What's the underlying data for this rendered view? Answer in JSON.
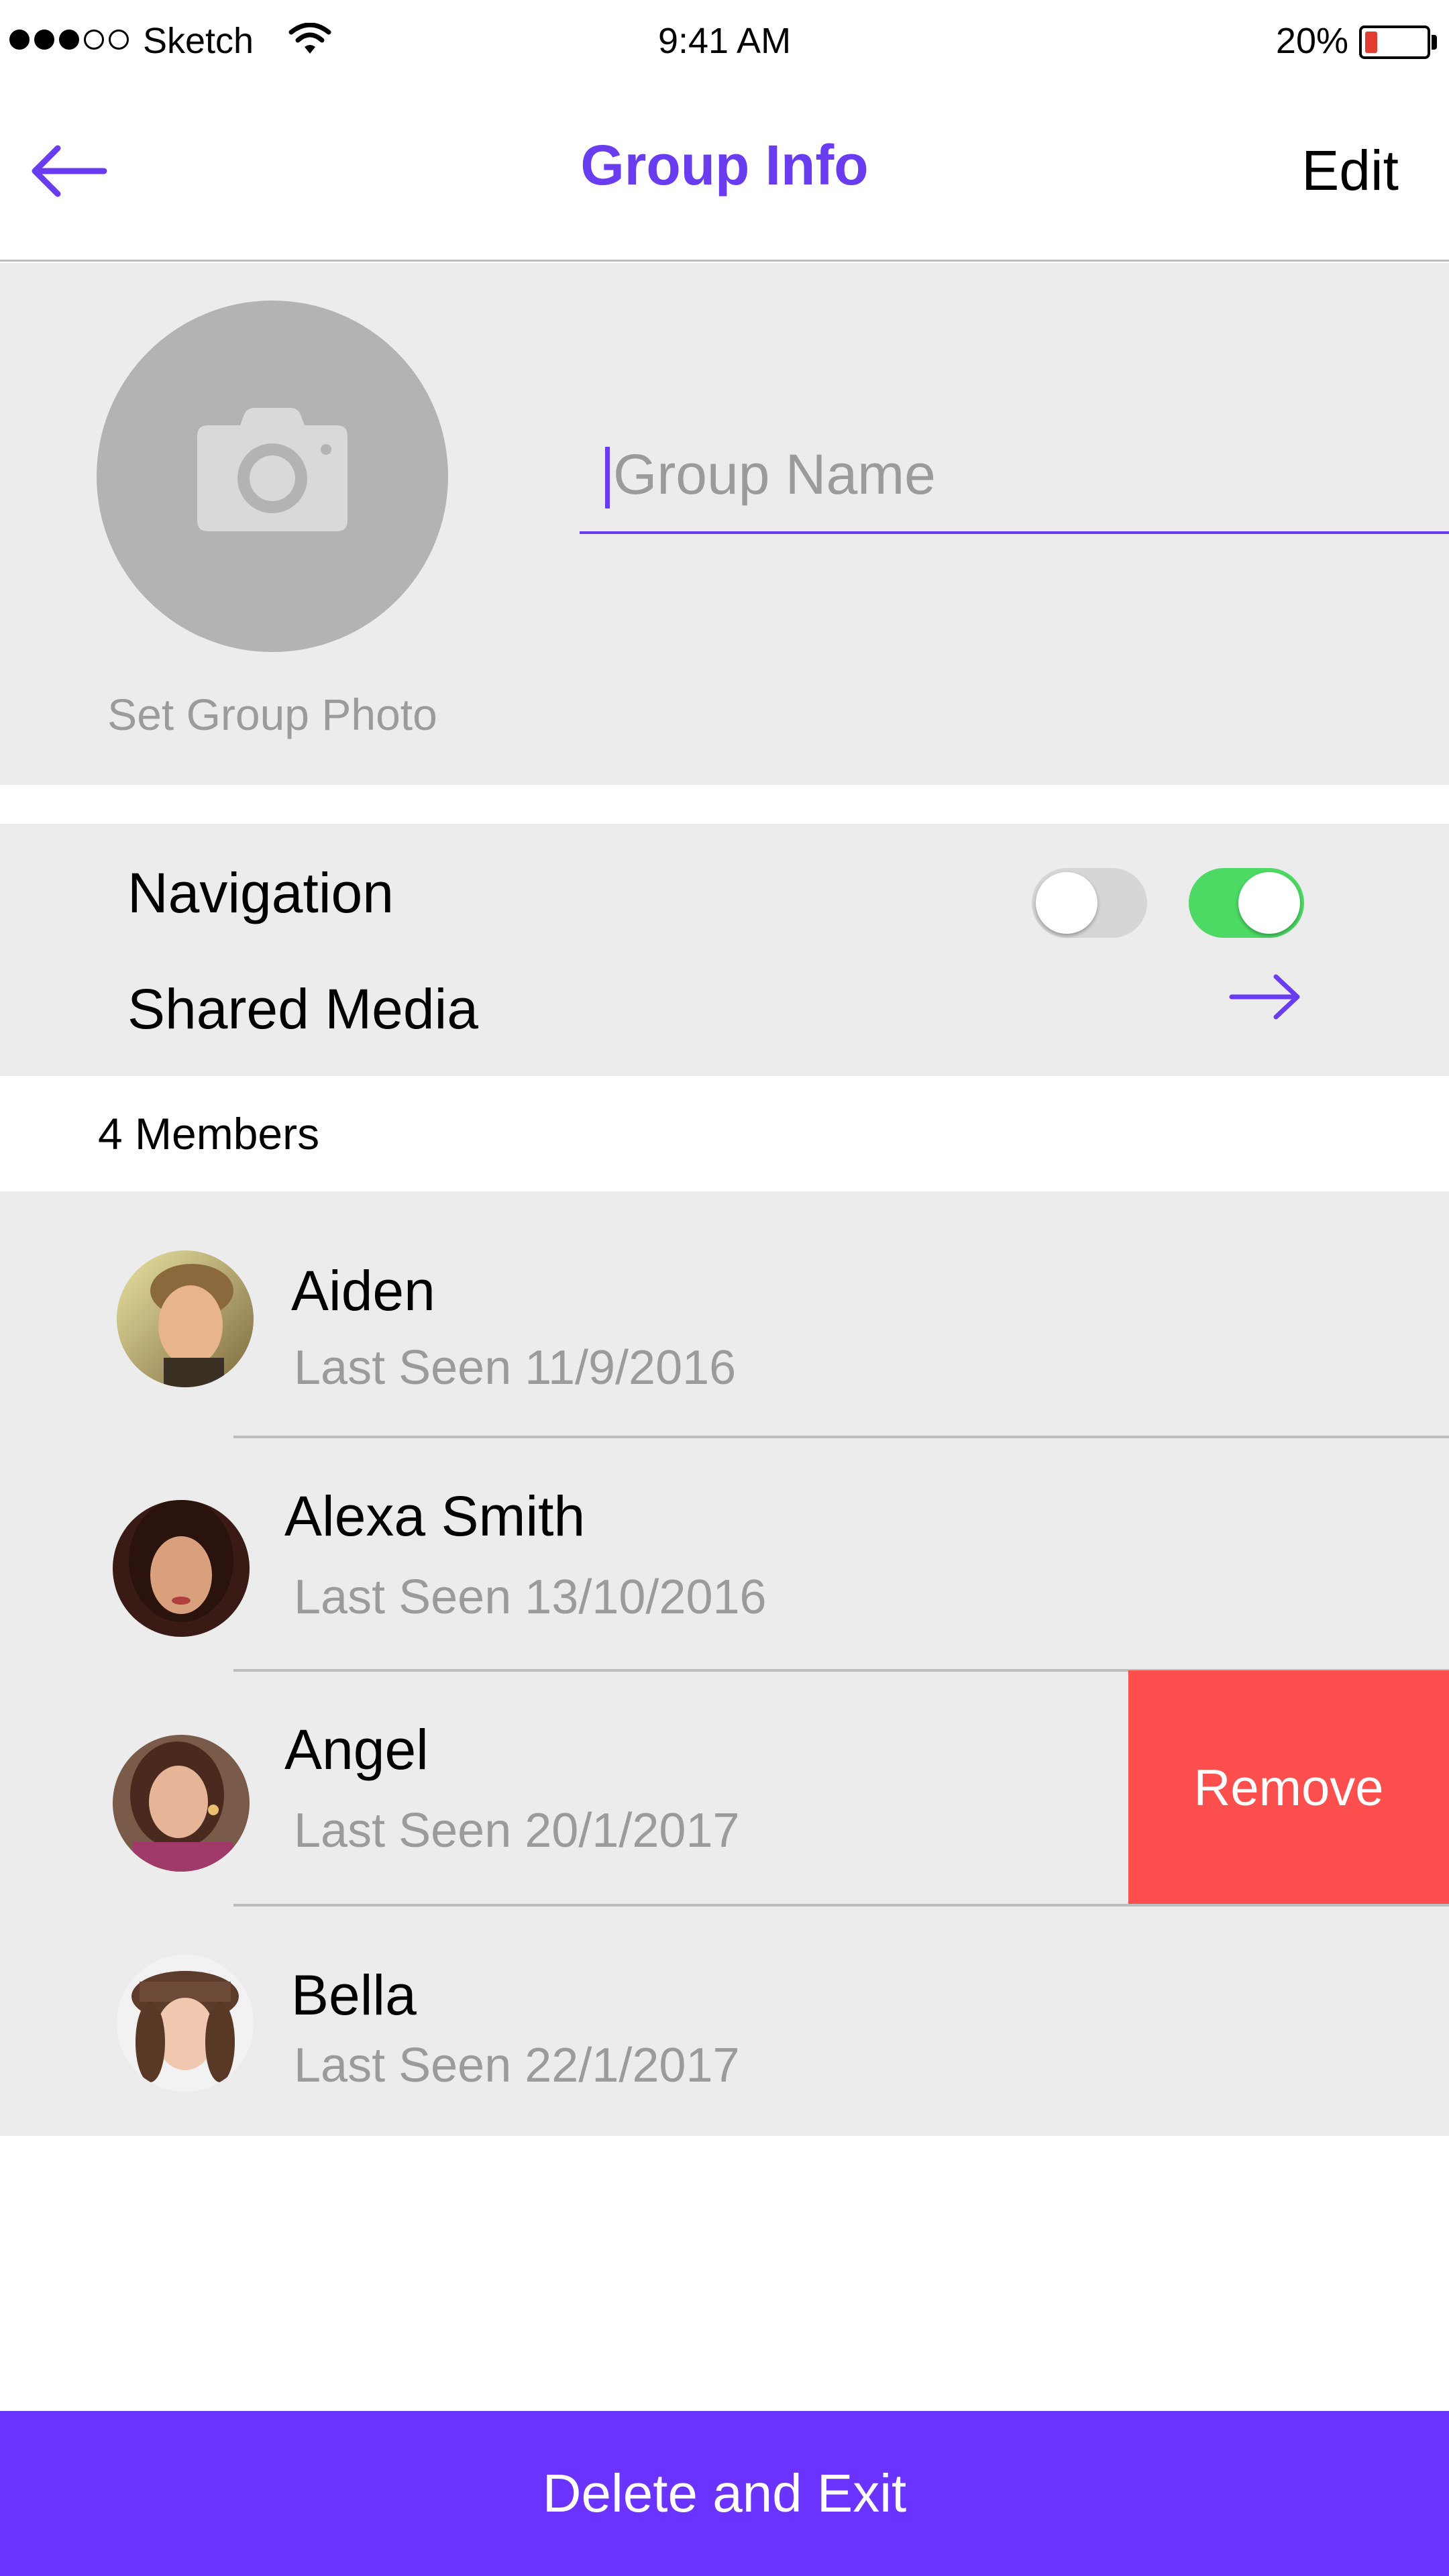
{
  "status_bar": {
    "carrier": "Sketch",
    "time": "9:41 AM",
    "battery_percent": "20%",
    "battery_level": 0.2,
    "signal_strength": 3,
    "signal_total": 5
  },
  "nav": {
    "title": "Group Info",
    "edit_label": "Edit",
    "back_icon": "arrow-left-icon"
  },
  "group": {
    "photo_label": "Set Group Photo",
    "name_placeholder": "Group Name",
    "camera_icon": "camera-icon"
  },
  "settings": {
    "items": [
      {
        "label": "Navigation"
      },
      {
        "label": "Shared Media"
      }
    ],
    "toggles": [
      {
        "state": "off"
      },
      {
        "state": "on"
      }
    ]
  },
  "members": {
    "count_label": "4 Members",
    "items": [
      {
        "name": "Aiden",
        "last_seen": "Last Seen 11/9/2016"
      },
      {
        "name": "Alexa Smith",
        "last_seen": "Last Seen 13/10/2016"
      },
      {
        "name": "Angel",
        "last_seen": "Last Seen 20/1/2017"
      },
      {
        "name": "Bella",
        "last_seen": "Last Seen 22/1/2017"
      }
    ],
    "remove_label": "Remove"
  },
  "footer": {
    "delete_exit_label": "Delete and Exit"
  },
  "colors": {
    "accent": "#6a3cf0",
    "primary_button": "#6a33ff",
    "remove": "#fe4f4f",
    "toggle_on": "#4cd964",
    "section_bg": "#ececec"
  }
}
